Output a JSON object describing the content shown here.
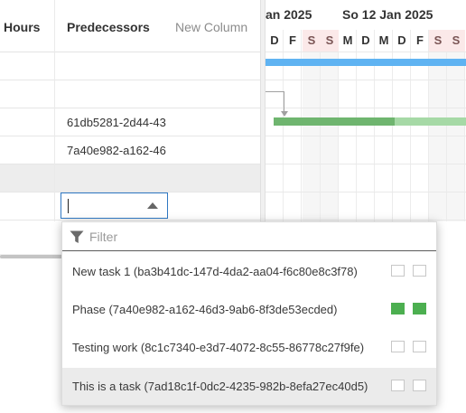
{
  "grid": {
    "headers": {
      "hours": "Hours",
      "predecessors": "Predecessors",
      "new_column": "New Column"
    },
    "rows": [
      {
        "predecessors": ""
      },
      {
        "predecessors": ""
      },
      {
        "predecessors": "61db5281-2d44-43"
      },
      {
        "predecessors": "7a40e982-a162-46"
      },
      {
        "predecessors": ""
      },
      {
        "predecessors": ""
      },
      {
        "predecessors": ""
      }
    ],
    "editor_value": ""
  },
  "gantt": {
    "weeks": [
      "an 2025",
      "So 12 Jan 2025"
    ],
    "days": [
      "D",
      "F",
      "S",
      "S",
      "M",
      "D",
      "M",
      "D",
      "F",
      "S",
      "S"
    ],
    "weekend_flags": [
      false,
      false,
      true,
      true,
      false,
      false,
      false,
      false,
      false,
      true,
      true
    ]
  },
  "dropdown": {
    "filter_placeholder": "Filter",
    "options": [
      {
        "label": "New task 1 (ba3b41dc-147d-4da2-aa04-f6c80e8c3f78)",
        "checked": false
      },
      {
        "label": "Phase (7a40e982-a162-46d3-9ab6-8f3de53ecded)",
        "checked": true
      },
      {
        "label": "Testing work (8c1c7340-e3d7-4072-8c55-86778c27f9fe)",
        "checked": false
      },
      {
        "label": "This is a task (7ad18c1f-0dc2-4235-982b-8efa27ec40d5)",
        "checked": false
      }
    ]
  },
  "colors": {
    "accent": "#2e77c2",
    "checked": "#4caf50",
    "bar_blue": "#5fb3f2",
    "bar_green": "#6fb56f",
    "bar_green_light": "#a6d9a6"
  }
}
